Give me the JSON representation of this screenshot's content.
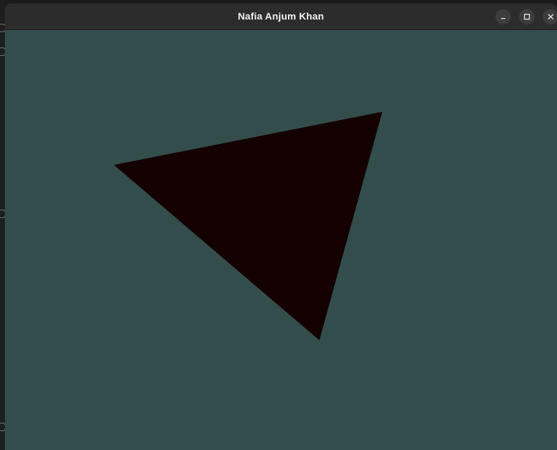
{
  "window": {
    "title": "Nafia Anjum Khan",
    "controls": {
      "minimize_icon": "minimize-icon",
      "maximize_icon": "maximize-icon",
      "close_icon": "close-icon"
    }
  },
  "canvas": {
    "clear_color": "#334d4d",
    "shape": {
      "type": "triangle",
      "fill_color": "#150000"
    }
  }
}
